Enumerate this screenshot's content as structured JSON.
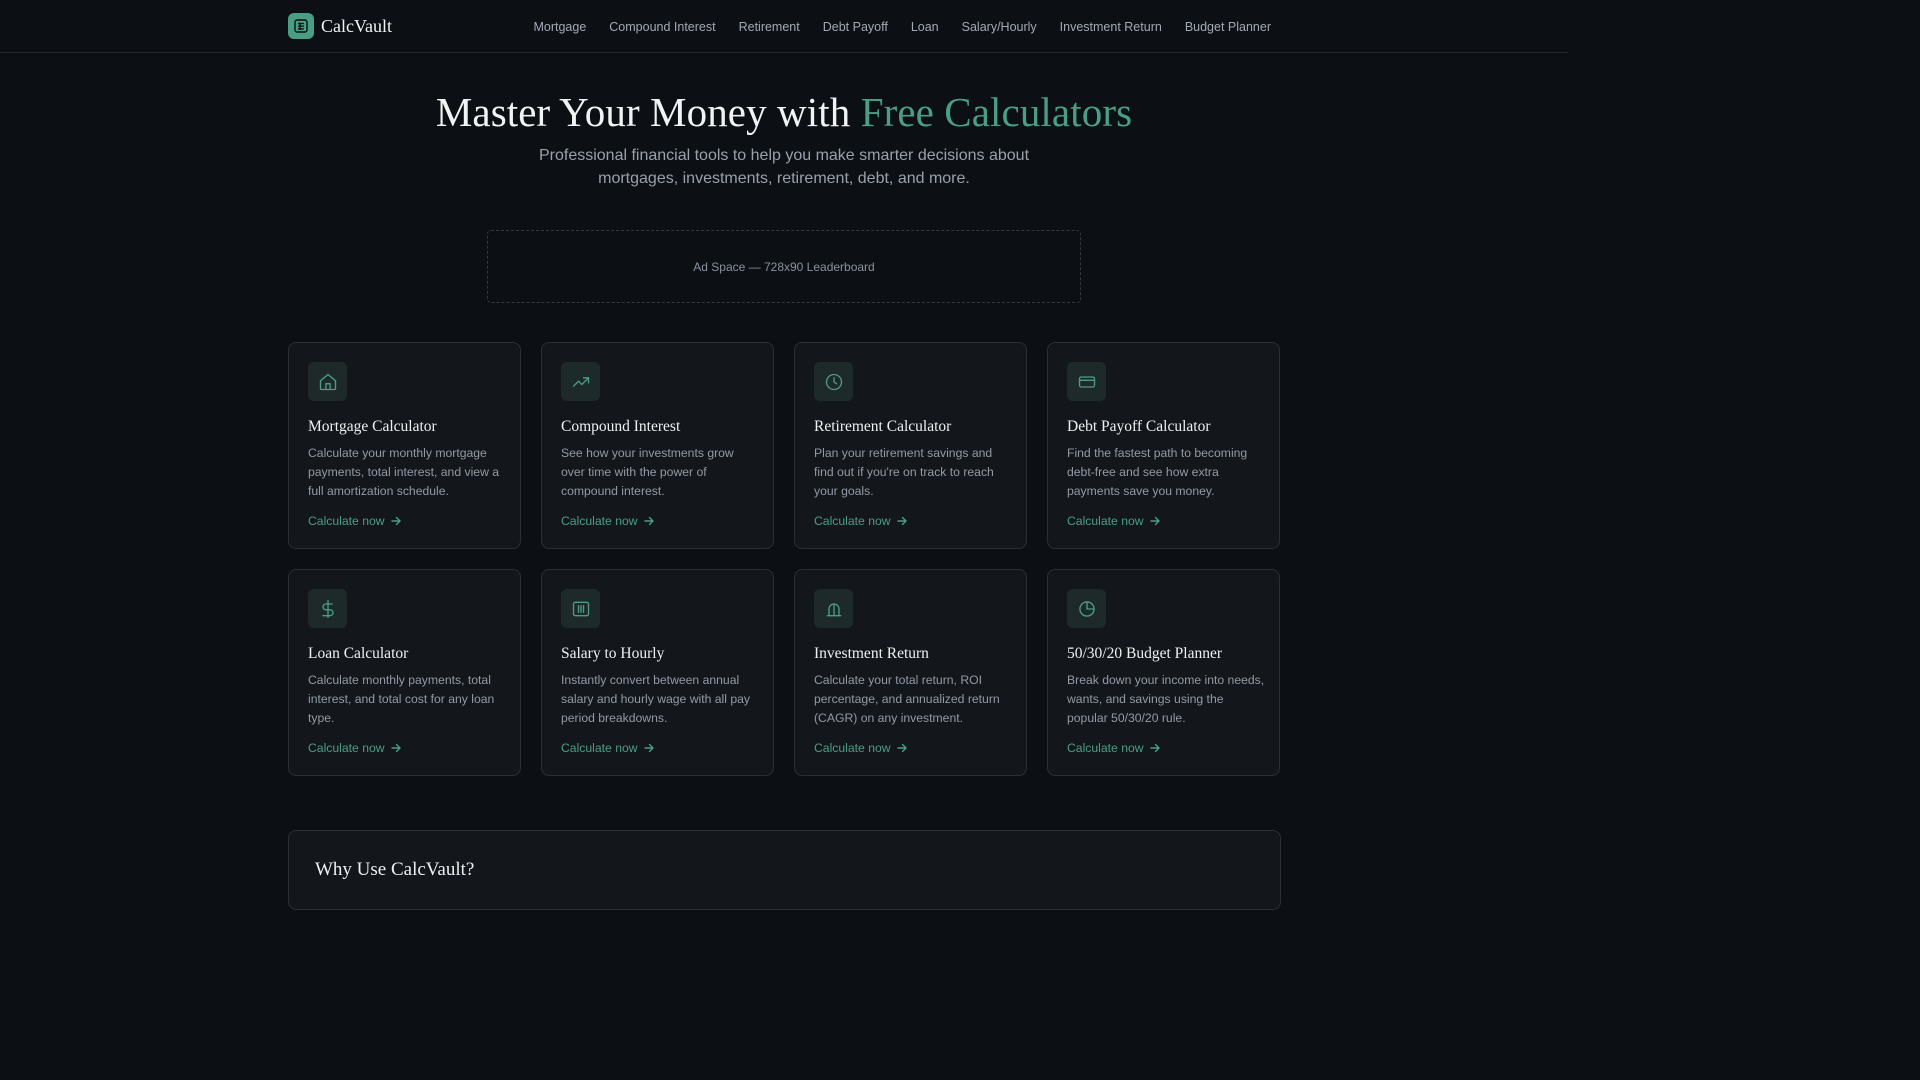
{
  "brand": {
    "name": "CalcVault",
    "accent_color": "#4a9e84"
  },
  "nav": {
    "items": [
      {
        "label": "Mortgage"
      },
      {
        "label": "Compound Interest"
      },
      {
        "label": "Retirement"
      },
      {
        "label": "Debt Payoff"
      },
      {
        "label": "Loan"
      },
      {
        "label": "Salary/Hourly"
      },
      {
        "label": "Investment Return"
      },
      {
        "label": "Budget Planner"
      }
    ]
  },
  "hero": {
    "title_lead": "Master Your Money with ",
    "title_accent": "Free Calculators",
    "subtitle": "Professional financial tools to help you make smarter decisions about mortgages, investments, retirement, debt, and more."
  },
  "ad": {
    "label": "Ad Space — 728x90 Leaderboard"
  },
  "cards": [
    {
      "icon": "home-icon",
      "title": "Mortgage Calculator",
      "description": "Calculate your monthly mortgage payments, total interest, and view a full amortization schedule.",
      "link": "Calculate now"
    },
    {
      "icon": "trending-up-icon",
      "title": "Compound Interest",
      "description": "See how your investments grow over time with the power of compound interest.",
      "link": "Calculate now"
    },
    {
      "icon": "clock-icon",
      "title": "Retirement Calculator",
      "description": "Plan your retirement savings and find out if you're on track to reach your goals.",
      "link": "Calculate now"
    },
    {
      "icon": "credit-card-icon",
      "title": "Debt Payoff Calculator",
      "description": "Find the fastest path to becoming debt-free and see how extra payments save you money.",
      "link": "Calculate now"
    },
    {
      "icon": "dollar-icon",
      "title": "Loan Calculator",
      "description": "Calculate monthly payments, total interest, and total cost for any loan type.",
      "link": "Calculate now"
    },
    {
      "icon": "columns-icon",
      "title": "Salary to Hourly",
      "description": "Instantly convert between annual salary and hourly wage with all pay period breakdowns.",
      "link": "Calculate now"
    },
    {
      "icon": "bar-chart-icon",
      "title": "Investment Return",
      "description": "Calculate your total return, ROI percentage, and annualized return (CAGR) on any investment.",
      "link": "Calculate now"
    },
    {
      "icon": "pie-chart-icon",
      "title": "50/30/20 Budget Planner",
      "description": "Break down your income into needs, wants, and savings using the popular 50/30/20 rule.",
      "link": "Calculate now"
    }
  ],
  "why": {
    "title": "Why Use CalcVault?"
  }
}
